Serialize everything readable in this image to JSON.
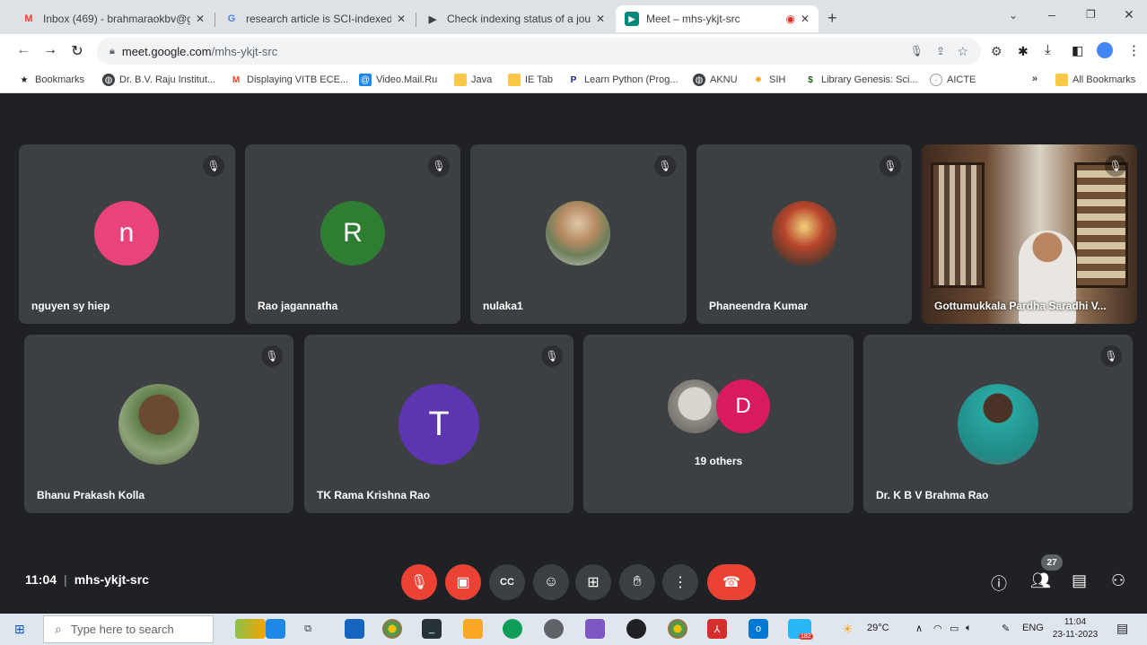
{
  "browser": {
    "tabs": [
      {
        "label": "Inbox (469) - brahmaraokbv@gr",
        "icon": "gmail-icon",
        "color": "#ea4335"
      },
      {
        "label": "research article is SCI-indexed o",
        "icon": "google-icon",
        "color": "#4285f4"
      },
      {
        "label": "Check indexing status of a journ",
        "icon": "publisher-icon",
        "color": "#3c4043"
      },
      {
        "label": "Meet – mhs-ykjt-src",
        "icon": "meet-icon",
        "color": "#00897b"
      }
    ],
    "new_tab_label": "+",
    "url_host": "meet.google.com",
    "url_path": "/mhs-ykjt-src",
    "bookmarks": [
      {
        "label": "Bookmarks",
        "icon": "star-icon"
      },
      {
        "label": "Dr. B.V. Raju Institut...",
        "icon": "globe-icon"
      },
      {
        "label": "Displaying VITB ECE...",
        "icon": "gmail-icon"
      },
      {
        "label": "Video.Mail.Ru",
        "icon": "mailru-icon"
      },
      {
        "label": "Java",
        "icon": "folder-icon"
      },
      {
        "label": "IE Tab",
        "icon": "folder-icon"
      },
      {
        "label": "Learn Python (Prog...",
        "icon": "python-icon"
      },
      {
        "label": "AKNU",
        "icon": "globe-icon"
      },
      {
        "label": "SIH",
        "icon": "sih-icon"
      },
      {
        "label": "Library Genesis: Sci...",
        "icon": "library-icon"
      },
      {
        "label": "AICTE",
        "icon": "aicte-icon"
      }
    ],
    "overflow_label": "»",
    "all_bookmarks_label": "All Bookmarks"
  },
  "meet": {
    "top_row": [
      {
        "name": "nguyen sy hiep",
        "avatar_letter": "n",
        "avatar_color": "#e8437a"
      },
      {
        "name": "Rao jagannatha",
        "avatar_letter": "R",
        "avatar_color": "#2e7d32"
      },
      {
        "name": "nulaka1",
        "avatar_letter": "",
        "avatar_color": "photo"
      },
      {
        "name": "Phaneendra Kumar",
        "avatar_letter": "",
        "avatar_color": "photo"
      },
      {
        "name": "Gottumukkala Pardha Saradhi V...",
        "avatar_letter": "",
        "avatar_color": "video"
      }
    ],
    "bottom_row": [
      {
        "name": "Bhanu Prakash Kolla",
        "avatar_letter": "",
        "avatar_color": "photo"
      },
      {
        "name": "TK Rama Krishna Rao",
        "avatar_letter": "T",
        "avatar_color": "#5e35b1"
      },
      {
        "name": "",
        "avatar_letter": "D",
        "avatar_color": "#d81b60"
      },
      {
        "name": "Dr. K B V Brahma Rao",
        "avatar_letter": "",
        "avatar_color": "photo"
      }
    ],
    "others_label": "19 others",
    "time": "11:04",
    "meeting_code": "mhs-ykjt-src",
    "participant_count": "27"
  },
  "taskbar": {
    "search_placeholder": "Type here to search",
    "weather": "29°C",
    "language": "ENG",
    "clock_time": "11:04",
    "clock_date": "23-11-2023",
    "badge": "182"
  }
}
